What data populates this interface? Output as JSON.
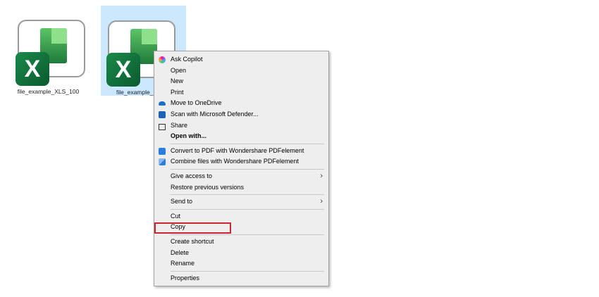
{
  "files": [
    {
      "name": "file_example_XLS_100"
    },
    {
      "name": "file_example_X"
    }
  ],
  "menu": {
    "group1": [
      {
        "label": "Ask Copilot",
        "icon": "copilot-icon"
      },
      {
        "label": "Open"
      },
      {
        "label": "New"
      },
      {
        "label": "Print"
      },
      {
        "label": "Move to OneDrive",
        "icon": "onedrive-icon"
      },
      {
        "label": "Scan with Microsoft Defender...",
        "icon": "defender-icon"
      },
      {
        "label": "Share",
        "icon": "share-icon"
      },
      {
        "label": "Open with..."
      }
    ],
    "group2": [
      {
        "label": "Convert to PDF with Wondershare PDFelement",
        "icon": "pdfelement-convert-icon"
      },
      {
        "label": "Combine files with Wondershare PDFelement",
        "icon": "pdfelement-combine-icon"
      }
    ],
    "group3": [
      {
        "label": "Give access to"
      },
      {
        "label": "Restore previous versions"
      }
    ],
    "group4": [
      {
        "label": "Send to"
      }
    ],
    "group5": [
      {
        "label": "Cut"
      },
      {
        "label": "Copy"
      }
    ],
    "group6": [
      {
        "label": "Create shortcut"
      },
      {
        "label": "Delete"
      },
      {
        "label": "Rename"
      }
    ],
    "group7": [
      {
        "label": "Properties"
      }
    ]
  },
  "colors": {
    "selection": "#cce8ff",
    "highlight": "#d0242f"
  }
}
